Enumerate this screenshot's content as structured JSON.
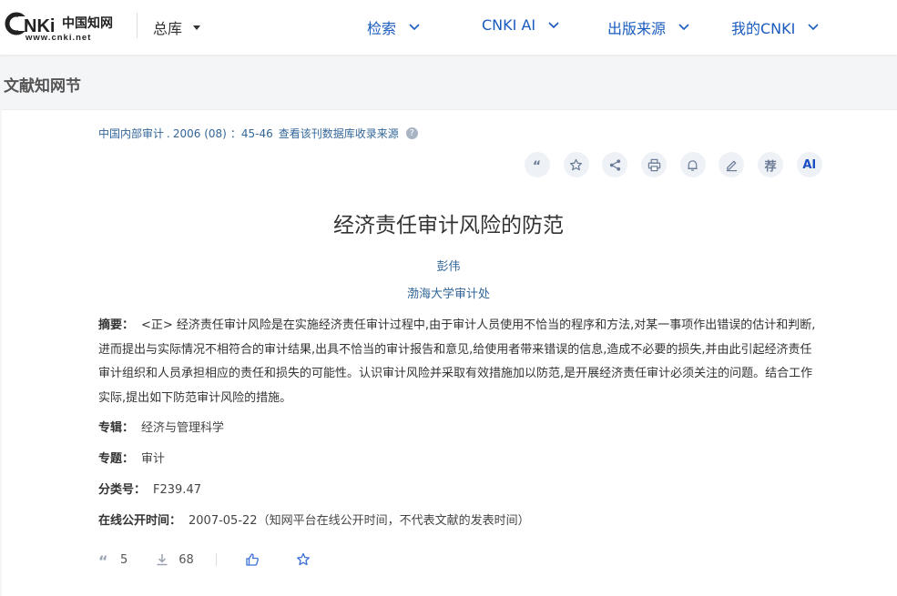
{
  "header": {
    "logo_text": "CNKi中国知网",
    "logo_url_text": "www.cnki.net",
    "zongku": "总库",
    "nav": [
      {
        "label": "检索"
      },
      {
        "label": "CNKI AI"
      },
      {
        "label": "出版来源"
      },
      {
        "label": "我的CNKI"
      }
    ]
  },
  "section_title": "文献知网节",
  "article": {
    "source": {
      "journal": "中国内部审计",
      "dot": ".",
      "issue": "2006 (08)",
      "pages": "：45-46",
      "check_link": "查看该刊数据库收录来源",
      "help": "?"
    },
    "toolbar": [
      {
        "name": "cite-icon",
        "kind": "quote"
      },
      {
        "name": "favorite-icon",
        "kind": "star"
      },
      {
        "name": "share-icon",
        "kind": "share"
      },
      {
        "name": "print-icon",
        "kind": "print"
      },
      {
        "name": "notify-icon",
        "kind": "bell"
      },
      {
        "name": "note-icon",
        "kind": "pen"
      },
      {
        "name": "recommend-icon",
        "kind": "text",
        "text": "荐"
      },
      {
        "name": "ai-icon",
        "kind": "ai",
        "text": "AI"
      }
    ],
    "title": "经济责任审计风险的防范",
    "author": "彭伟",
    "organization": "渤海大学审计处",
    "abstract_label": "摘要：",
    "abstract": "<正> 经济责任审计风险是在实施经济责任审计过程中,由于审计人员使用不恰当的程序和方法,对某一事项作出错误的估计和判断,进而提出与实际情况不相符合的审计结果,出具不恰当的审计报告和意见,给使用者带来错误的信息,造成不必要的损失,并由此引起经济责任审计组织和人员承担相应的责任和损失的可能性。认识审计风险并采取有效措施加以防范,是开展经济责任审计必须关注的问题。结合工作实际,提出如下防范审计风险的措施。",
    "fields": [
      {
        "label": "专辑：",
        "value": "经济与管理科学"
      },
      {
        "label": "专题：",
        "value": "审计"
      },
      {
        "label": "分类号：",
        "value": "F239.47"
      },
      {
        "label": "在线公开时间：",
        "value": "2007-05-22（知网平台在线公开时间，不代表文献的发表时间）"
      }
    ],
    "stats": {
      "cited": "5",
      "downloads": "68"
    }
  }
}
